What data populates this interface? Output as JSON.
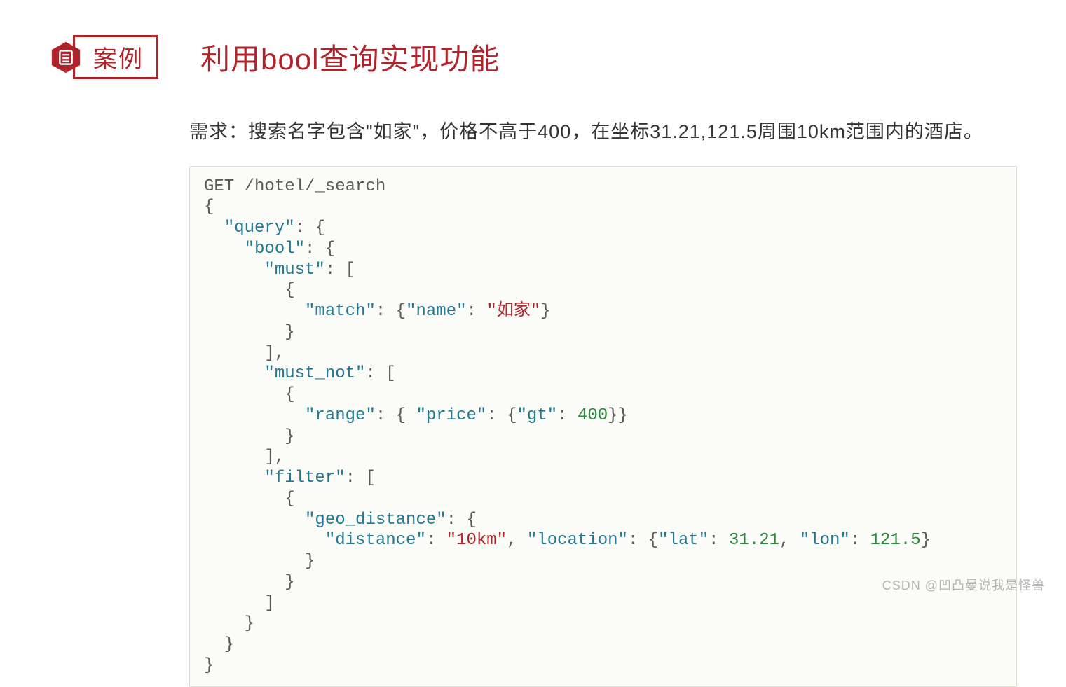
{
  "badge": {
    "label": "案例"
  },
  "title": "利用bool查询实现功能",
  "requirement": "需求：搜索名字包含\"如家\"，价格不高于400，在坐标31.21,121.5周围10km范围内的酒店。",
  "code": {
    "request_line": "GET /hotel/_search",
    "keys": {
      "query": "\"query\"",
      "bool": "\"bool\"",
      "must": "\"must\"",
      "match": "\"match\"",
      "name": "\"name\"",
      "must_not": "\"must_not\"",
      "range": "\"range\"",
      "price": "\"price\"",
      "gt": "\"gt\"",
      "filter": "\"filter\"",
      "geo_distance": "\"geo_distance\"",
      "distance": "\"distance\"",
      "location": "\"location\"",
      "lat": "\"lat\"",
      "lon": "\"lon\""
    },
    "values": {
      "name_val": "\"如家\"",
      "gt_val": "400",
      "distance_val": "\"10km\"",
      "lat_val": "31.21",
      "lon_val": "121.5"
    }
  },
  "watermark": "CSDN @凹凸曼说我是怪兽"
}
